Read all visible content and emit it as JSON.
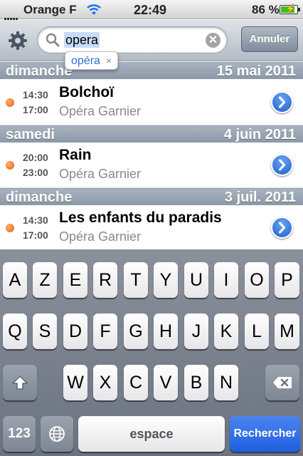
{
  "status_bar": {
    "carrier": "Orange F",
    "time": "22:49",
    "battery_percent": "86 %",
    "battery_level": 0.86,
    "icons": [
      "signal-bars-icon",
      "wifi-icon",
      "battery-charging-icon"
    ]
  },
  "search": {
    "query": "opera",
    "suggestion": "opéra",
    "suggestion_dismiss": "×",
    "clear_glyph": "✕",
    "cancel_label": "Annuler"
  },
  "sections": [
    {
      "day": "dimanche",
      "date": "15 mai 2011",
      "events": [
        {
          "start": "14:30",
          "end": "17:00",
          "title": "Bolchoï",
          "venue": "Opéra Garnier"
        }
      ]
    },
    {
      "day": "samedi",
      "date": "4 juin 2011",
      "events": [
        {
          "start": "20:00",
          "end": "23:00",
          "title": "Rain",
          "venue": "Opéra Garnier"
        }
      ]
    },
    {
      "day": "dimanche",
      "date": "3 juil. 2011",
      "events": [
        {
          "start": "14:30",
          "end": "17:00",
          "title": "Les enfants du paradis",
          "venue": "Opéra Garnier"
        }
      ]
    }
  ],
  "keyboard": {
    "row1": [
      "A",
      "Z",
      "E",
      "R",
      "T",
      "Y",
      "U",
      "I",
      "O",
      "P"
    ],
    "row2": [
      "Q",
      "S",
      "D",
      "F",
      "G",
      "H",
      "J",
      "K",
      "L",
      "M"
    ],
    "row3": [
      "W",
      "X",
      "C",
      "V",
      "B",
      "N"
    ],
    "numbers_label": "123",
    "space_label": "espace",
    "search_label": "Rechercher"
  },
  "colors": {
    "event_dot": "#e45c10",
    "accent_blue": "#1f5fe0",
    "wifi": "#1a73e8"
  }
}
